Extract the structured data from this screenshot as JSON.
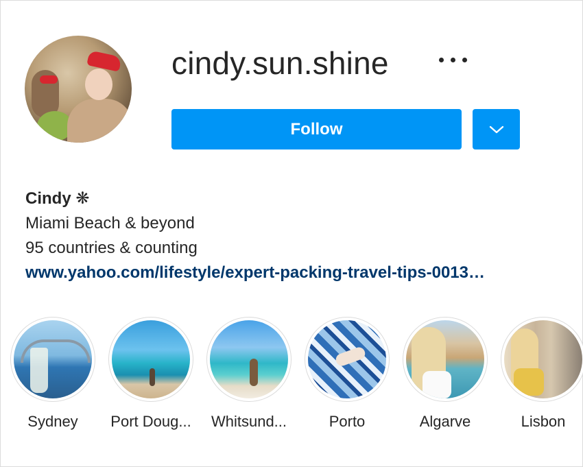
{
  "profile": {
    "username": "cindy.sun.shine",
    "display_name": "Cindy ❋",
    "bio_line1": "Miami Beach & beyond",
    "bio_line2": "95 countries & counting",
    "website": "www.yahoo.com/lifestyle/expert-packing-travel-tips-0013…"
  },
  "actions": {
    "follow_label": "Follow",
    "more_icon": "more-horizontal-icon",
    "dropdown_icon": "chevron-down-icon"
  },
  "highlights": [
    {
      "label": "Sydney"
    },
    {
      "label": "Port Doug..."
    },
    {
      "label": "Whitsund..."
    },
    {
      "label": "Porto"
    },
    {
      "label": "Algarve"
    },
    {
      "label": "Lisbon"
    }
  ],
  "colors": {
    "accent": "#0095f6",
    "link": "#00376b",
    "text": "#262626",
    "border": "#dbdbdb"
  }
}
